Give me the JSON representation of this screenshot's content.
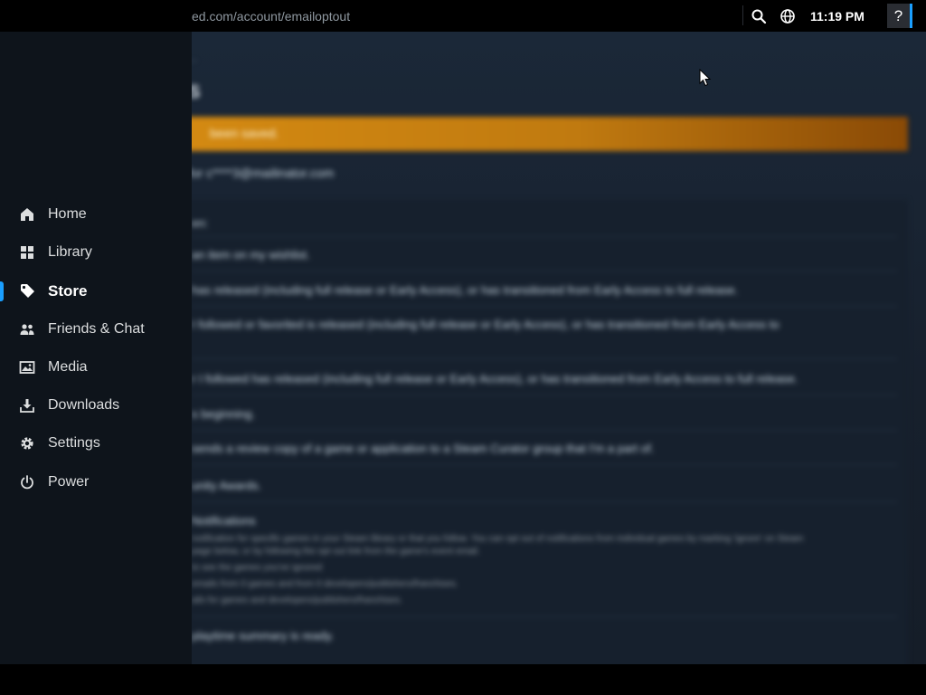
{
  "topbar": {
    "url": "ed.com/account/emailoptout",
    "clock": "11:19 PM",
    "help_label": "?",
    "icons": [
      "search-icon",
      "globe-icon"
    ]
  },
  "background_page": {
    "breadcrumb": "...",
    "title": "S",
    "banner_text": "been saved.",
    "email_line": "for c****3@mailinator.com",
    "options_header": "en:",
    "options": [
      "an item on my wishlist.",
      "has released (including full release or Early Access), or has transitioned from Early Access to full release.",
      "I followed or favorited is released (including full release or Early Access), or has transitioned from Early Access to",
      "r I followed has released (including full release or Early Access), or has transitioned from Early Access to full release.",
      "s beginning.",
      "sends a review copy of a game or application to a Steam Curator group that I'm a part of.",
      "unity Awards.",
      "Notifications",
      "playtime summary is ready."
    ],
    "notification_details": [
      "notification for specific games in your Steam library or that you follow. You can opt out of notifications from individual games by marking 'ignore' on Steam",
      "page below, or by following the opt out link from the game's event email.",
      "to see the games you've ignored",
      "emails from 0 games and from 0 developers/publishers/franchises.",
      "ails for games and developers/publishers/franchises."
    ]
  },
  "menu": {
    "items": [
      {
        "label": "Home",
        "icon": "home-icon"
      },
      {
        "label": "Library",
        "icon": "library-grid-icon"
      },
      {
        "label": "Store",
        "icon": "tag-icon"
      },
      {
        "label": "Friends & Chat",
        "icon": "friends-icon"
      },
      {
        "label": "Media",
        "icon": "media-icon"
      },
      {
        "label": "Downloads",
        "icon": "download-icon"
      },
      {
        "label": "Settings",
        "icon": "gear-icon"
      },
      {
        "label": "Power",
        "icon": "power-icon"
      }
    ],
    "active_item": "Store"
  },
  "colors": {
    "accent": "#1a9fff",
    "menu_bg": "#0e141b",
    "banner": "#d48a12"
  }
}
